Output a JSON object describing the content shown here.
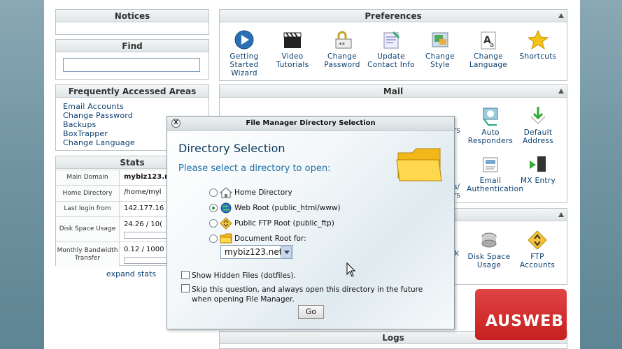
{
  "left_panels": {
    "notices": {
      "title": "Notices"
    },
    "find": {
      "title": "Find",
      "value": ""
    },
    "frequent": {
      "title": "Frequently Accessed Areas",
      "links": [
        "Email Accounts",
        "Change Password",
        "Backups",
        "BoxTrapper",
        "Change Language"
      ]
    },
    "stats": {
      "title": "Stats",
      "rows": [
        {
          "label": "Main Domain",
          "value": "mybiz123.n"
        },
        {
          "label": "Home Directory",
          "value": "/home/myl"
        },
        {
          "label": "Last login from",
          "value": "142.177.16"
        },
        {
          "label": "Disk Space Usage",
          "value": "24.26 / 10("
        },
        {
          "label": "Monthly Bandwidth Transfer",
          "value": "0.12 / 1000"
        }
      ],
      "expand": "expand stats"
    }
  },
  "preferences": {
    "title": "Preferences",
    "items": [
      {
        "label": "Getting Started Wizard",
        "icon": "play-icon"
      },
      {
        "label": "Video Tutorials",
        "icon": "clapperboard-icon"
      },
      {
        "label": "Change Password",
        "icon": "lock-icon"
      },
      {
        "label": "Update Contact Info",
        "icon": "contact-icon"
      },
      {
        "label": "Change Style",
        "icon": "style-icon"
      },
      {
        "label": "Change Language",
        "icon": "language-icon"
      },
      {
        "label": "Shortcuts",
        "icon": "star-icon"
      }
    ]
  },
  "mail": {
    "title": "Mail",
    "items": [
      {
        "label": "Auto Responders",
        "icon": "autoresponder-icon"
      },
      {
        "label": "Default Address",
        "icon": "default-address-icon"
      },
      {
        "label": "Email Authentication",
        "icon": "email-auth-icon"
      },
      {
        "label": "MX Entry",
        "icon": "mx-entry-icon"
      }
    ],
    "partial": [
      "rs",
      "s/",
      "rs"
    ]
  },
  "files": {
    "items": [
      {
        "label": "Disk Space Usage",
        "icon": "disk-icon"
      },
      {
        "label": "FTP Accounts",
        "icon": "ftp-icon"
      }
    ],
    "partial": "k"
  },
  "logs": {
    "title": "Logs"
  },
  "dialog": {
    "title": "File Manager Directory Selection",
    "close": "X",
    "heading": "Directory Selection",
    "subheading": "Please select a directory to open:",
    "options": [
      {
        "label": "Home Directory",
        "selected": false
      },
      {
        "label": "Web Root (public_html/www)",
        "selected": true
      },
      {
        "label": "Public FTP Root (public_ftp)",
        "selected": false
      },
      {
        "label": "Document Root for:",
        "selected": false
      }
    ],
    "domain_select": "mybiz123.net",
    "show_hidden": "Show Hidden Files (dotfiles).",
    "skip_question": "Skip this question, and always open this directory in the future when opening File Manager.",
    "go": "Go"
  },
  "brand": {
    "text": "AUSWEB",
    "color": "#d43030"
  }
}
